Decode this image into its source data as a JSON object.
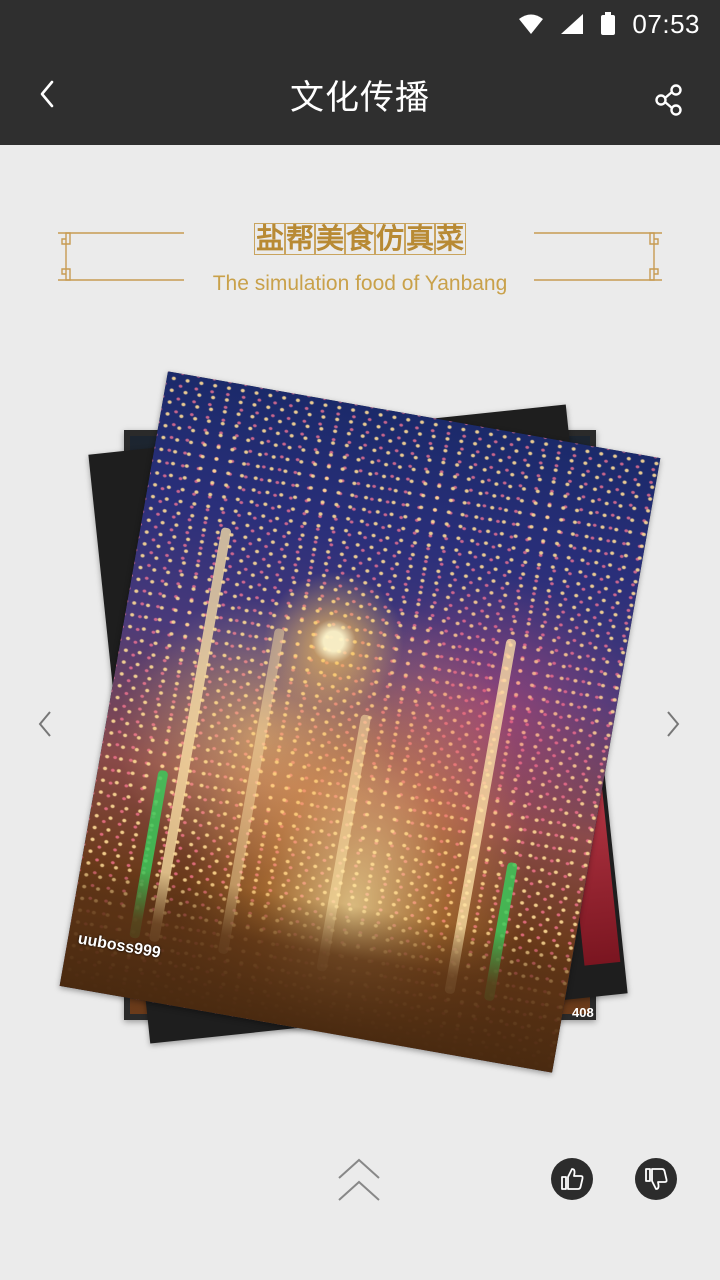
{
  "status_bar": {
    "time": "07:53"
  },
  "header": {
    "title": "文化传播"
  },
  "banner": {
    "title_chars": [
      "盐",
      "帮",
      "美",
      "食",
      "仿",
      "真",
      "菜"
    ],
    "subtitle": "The simulation food of Yanbang"
  },
  "gallery": {
    "watermark_main": "uuboss999",
    "watermark_back": "408"
  },
  "icons": {
    "back": "chevron-left-icon",
    "share": "share-icon",
    "prev": "chevron-left-icon",
    "next": "chevron-right-icon",
    "expand": "double-chevron-up-icon",
    "like": "thumbs-up-icon",
    "dislike": "thumbs-down-icon"
  },
  "colors": {
    "header_bg": "#2f2f2f",
    "page_bg": "#ebebeb",
    "banner_gold": "#b88a34"
  }
}
